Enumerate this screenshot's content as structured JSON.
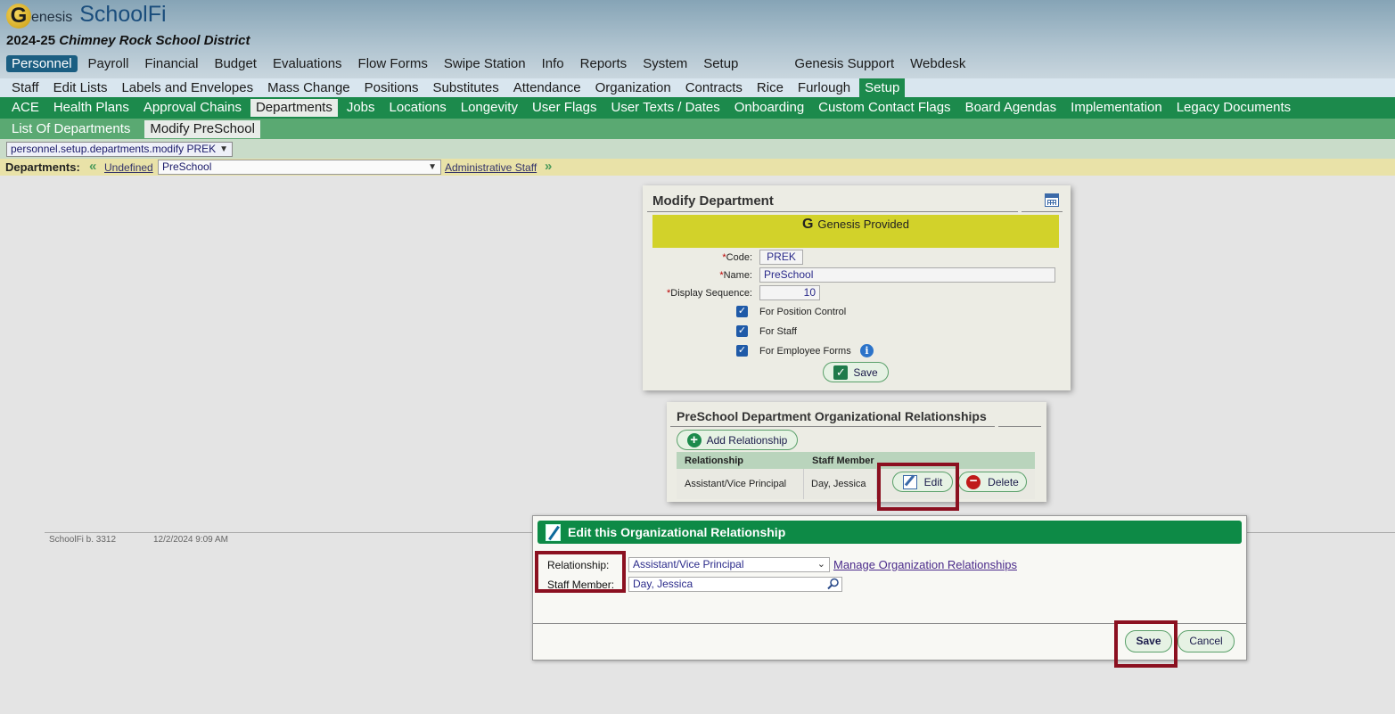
{
  "header": {
    "logo_letter": "G",
    "logo_brand": "enesis",
    "app_name": "SchoolFi",
    "year": "2024-25",
    "district": "Chimney Rock School District"
  },
  "top_nav": [
    "Personnel",
    "Payroll",
    "Financial",
    "Budget",
    "Evaluations",
    "Flow Forms",
    "Swipe Station",
    "Info",
    "Reports",
    "System",
    "Setup",
    "Genesis Support",
    "Webdesk"
  ],
  "sub_nav": [
    "Staff",
    "Edit Lists",
    "Labels and Envelopes",
    "Mass Change",
    "Positions",
    "Substitutes",
    "Attendance",
    "Organization",
    "Contracts",
    "Rice",
    "Furlough",
    "Setup"
  ],
  "setup_nav": [
    "ACE",
    "Health Plans",
    "Approval Chains",
    "Departments",
    "Jobs",
    "Locations",
    "Longevity",
    "User Flags",
    "User Texts / Dates",
    "Onboarding",
    "Custom Contact Flags",
    "Board Agendas",
    "Implementation",
    "Legacy Documents"
  ],
  "dept_nav": [
    "List Of Departments",
    "Modify PreSchool"
  ],
  "path_select": "personnel.setup.departments.modify PREK",
  "dept_bar": {
    "label": "Departments:",
    "prev": "Undefined",
    "current": "PreSchool",
    "next": "Administrative Staff"
  },
  "modify_panel": {
    "title": "Modify Department",
    "banner_icon": "G",
    "banner": "Genesis Provided",
    "code_label": "Code:",
    "code_value": "PREK",
    "name_label": "Name:",
    "name_value": "PreSchool",
    "seq_label": "Display Sequence:",
    "seq_value": "10",
    "req_mark": "*",
    "checkboxes": [
      "For Position Control",
      "For Staff",
      "For Employee Forms"
    ],
    "info_glyph": "i",
    "save": "Save"
  },
  "relationships_panel": {
    "title": "PreSchool Department Organizational Relationships",
    "add_button": "Add Relationship",
    "headers": [
      "Relationship",
      "Staff Member"
    ],
    "rows": [
      {
        "relationship": "Assistant/Vice Principal",
        "staff": "Day, Jessica"
      }
    ],
    "edit": "Edit",
    "delete": "Delete"
  },
  "footer": {
    "build": "SchoolFi b. 3312",
    "timestamp": "12/2/2024 9:09 AM"
  },
  "dialog": {
    "title": "Edit this Organizational Relationship",
    "relationship_label": "Relationship:",
    "relationship_value": "Assistant/Vice Principal",
    "manage_link": "Manage Organization Relationships",
    "staff_label": "Staff Member:",
    "staff_value": "Day, Jessica",
    "save": "Save",
    "cancel": "Cancel"
  },
  "colors": {
    "nav_green": "#1c8a4c",
    "highlight": "#8b1020",
    "banner_yellow": "#d2d22a"
  }
}
